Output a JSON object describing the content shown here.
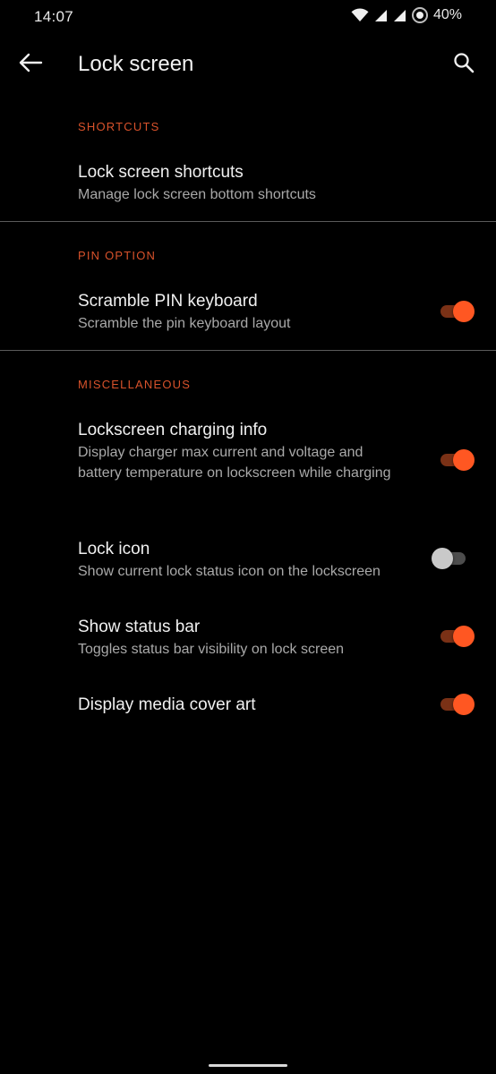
{
  "status_bar": {
    "time": "14:07",
    "battery_percent": "40%",
    "icons": [
      "wifi-icon",
      "cell-signal-icon",
      "cell-signal-icon",
      "data-saver-icon"
    ]
  },
  "app_bar": {
    "back_icon": "arrow-left-icon",
    "title": "Lock screen",
    "search_icon": "search-icon"
  },
  "sections": {
    "shortcuts": {
      "header": "SHORTCUTS",
      "items": [
        {
          "title": "Lock screen shortcuts",
          "summary": "Manage lock screen bottom shortcuts"
        }
      ]
    },
    "pin_option": {
      "header": "PIN OPTION",
      "items": [
        {
          "title": "Scramble PIN keyboard",
          "summary": "Scramble the pin keyboard layout",
          "enabled": true
        }
      ]
    },
    "miscellaneous": {
      "header": "MISCELLANEOUS",
      "items": [
        {
          "title": "Lockscreen charging info",
          "summary": "Display charger max current and voltage and battery temperature on lockscreen while charging",
          "enabled": true
        },
        {
          "title": "Lock icon",
          "summary": "Show current lock status icon on the lockscreen",
          "enabled": false
        },
        {
          "title": "Show status bar",
          "summary": "Toggles status bar visibility on lock screen",
          "enabled": true
        },
        {
          "title": "Display media cover art",
          "enabled": true
        }
      ]
    }
  },
  "colors": {
    "accent": "#ff5722",
    "section_header": "#d8522b",
    "background": "#000000"
  }
}
